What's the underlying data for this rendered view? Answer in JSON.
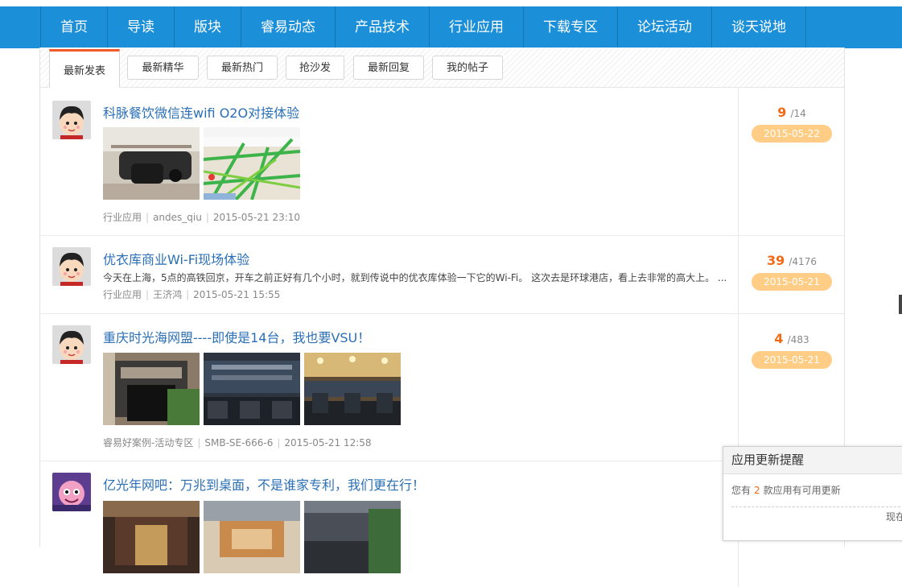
{
  "nav": {
    "items": [
      "首页",
      "导读",
      "版块",
      "睿易动态",
      "产品技术",
      "行业应用",
      "下载专区",
      "论坛活动",
      "谈天说地"
    ]
  },
  "tabs": [
    "最新发表",
    "最新精华",
    "最新热门",
    "抢沙发",
    "最新回复",
    "我的帖子"
  ],
  "posts": [
    {
      "title": "科脉餐饮微信连wifi O2O对接体验",
      "excerpt": "",
      "meta": [
        "行业应用",
        "andes_qiu",
        "2015-05-21 23:10"
      ],
      "replies": "9",
      "views": "/14",
      "date": "2015-05-22"
    },
    {
      "title": "优衣库商业Wi-Fi现场体验",
      "excerpt": "今天在上海，5点的高铁回京，开车之前正好有几个小时，就到传说中的优衣库体验一下它的Wi-Fi。 这次去是环球港店，看上去非常的高大上。 ...",
      "meta": [
        "行业应用",
        "王济鸿",
        "2015-05-21 15:55"
      ],
      "replies": "39",
      "views": "/4176",
      "date": "2015-05-21"
    },
    {
      "title": "重庆时光海网盟----即使是14台，我也要VSU！",
      "excerpt": "",
      "meta": [
        "睿易好案例-活动专区",
        "SMB-SE-666-6",
        "2015-05-21 12:58"
      ],
      "replies": "4",
      "views": "/483",
      "date": "2015-05-21"
    },
    {
      "title": "亿光年网吧：万兆到桌面，不是谁家专利，我们更在行！",
      "excerpt": "",
      "meta": [],
      "replies": "",
      "views": "",
      "date": ""
    }
  ],
  "popup": {
    "title": "应用更新提醒",
    "prefix": "您有",
    "count": "2",
    "suffix": "款应用有可用更新",
    "action": "现在"
  },
  "colors": {
    "nav_bg": "#1b8fd8",
    "accent": "#f26a16",
    "link": "#2a6fb6",
    "date_badge": "#ffcd85",
    "tab_active_border": "#f05a2b"
  },
  "icons": {
    "avatar": "cartoon-boy-avatar",
    "avatar_alt": "cartoon-purple-avatar"
  }
}
